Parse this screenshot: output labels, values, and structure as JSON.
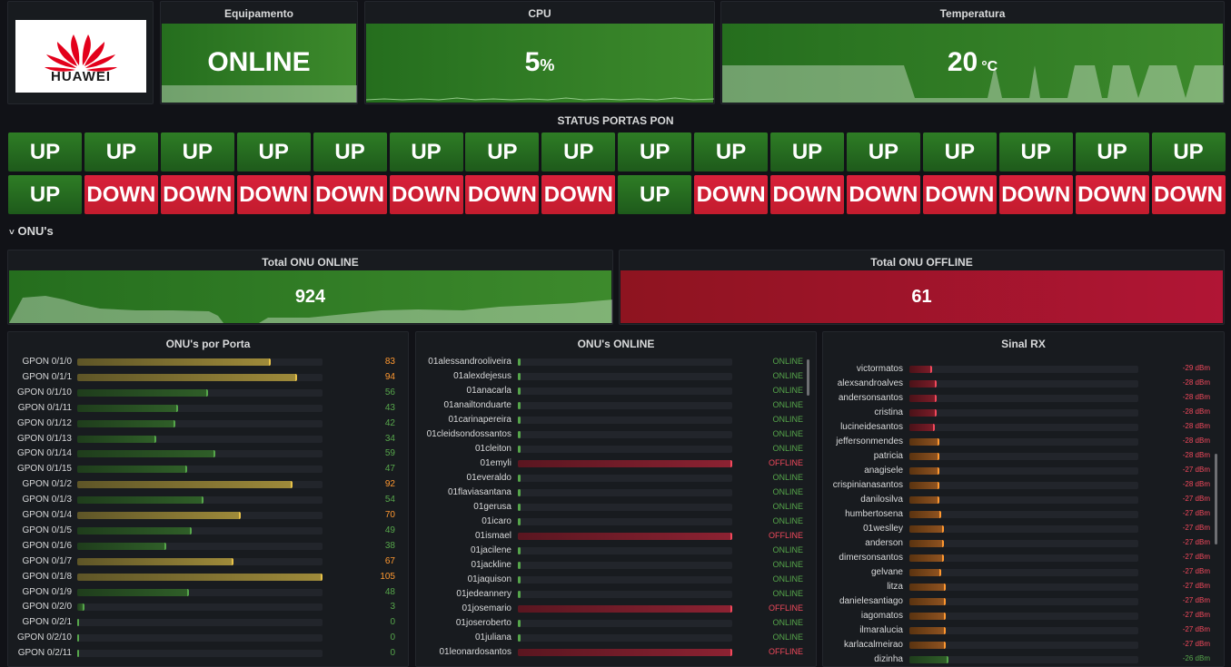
{
  "logo": {
    "brand": "HUAWEI",
    "color": "#e3001b"
  },
  "equipamento": {
    "title": "Equipamento",
    "value": "ONLINE"
  },
  "cpu": {
    "title": "CPU",
    "value": "5",
    "unit": "%"
  },
  "temperatura": {
    "title": "Temperatura",
    "value": "20",
    "unit": "°C"
  },
  "pon": {
    "title": "STATUS PORTAS PON",
    "row1": [
      "UP",
      "UP",
      "UP",
      "UP",
      "UP",
      "UP",
      "UP",
      "UP",
      "UP",
      "UP",
      "UP",
      "UP",
      "UP",
      "UP",
      "UP",
      "UP"
    ],
    "row2": [
      "UP",
      "DOWN",
      "DOWN",
      "DOWN",
      "DOWN",
      "DOWN",
      "DOWN",
      "DOWN",
      "UP",
      "DOWN",
      "DOWN",
      "DOWN",
      "DOWN",
      "DOWN",
      "DOWN",
      "DOWN"
    ]
  },
  "onus_row": {
    "title": "ONU's",
    "chevron": "chevron-down-icon"
  },
  "total_online": {
    "title": "Total ONU ONLINE",
    "value": "924"
  },
  "total_offline": {
    "title": "Total ONU OFFLINE",
    "value": "61"
  },
  "por_porta": {
    "title": "ONU's por Porta",
    "max": 105,
    "items": [
      {
        "label": "GPON 0/1/0",
        "value": 83,
        "color": "orange"
      },
      {
        "label": "GPON 0/1/1",
        "value": 94,
        "color": "orange"
      },
      {
        "label": "GPON 0/1/10",
        "value": 56,
        "color": "green"
      },
      {
        "label": "GPON 0/1/11",
        "value": 43,
        "color": "green"
      },
      {
        "label": "GPON 0/1/12",
        "value": 42,
        "color": "green"
      },
      {
        "label": "GPON 0/1/13",
        "value": 34,
        "color": "green"
      },
      {
        "label": "GPON 0/1/14",
        "value": 59,
        "color": "green"
      },
      {
        "label": "GPON 0/1/15",
        "value": 47,
        "color": "green"
      },
      {
        "label": "GPON 0/1/2",
        "value": 92,
        "color": "orange"
      },
      {
        "label": "GPON 0/1/3",
        "value": 54,
        "color": "green"
      },
      {
        "label": "GPON 0/1/4",
        "value": 70,
        "color": "orange"
      },
      {
        "label": "GPON 0/1/5",
        "value": 49,
        "color": "green"
      },
      {
        "label": "GPON 0/1/6",
        "value": 38,
        "color": "green"
      },
      {
        "label": "GPON 0/1/7",
        "value": 67,
        "color": "orange"
      },
      {
        "label": "GPON 0/1/8",
        "value": 105,
        "color": "orange"
      },
      {
        "label": "GPON 0/1/9",
        "value": 48,
        "color": "green"
      },
      {
        "label": "GPON 0/2/0",
        "value": 3,
        "color": "green"
      },
      {
        "label": "GPON 0/2/1",
        "value": 0,
        "color": "green"
      },
      {
        "label": "GPON 0/2/10",
        "value": 0,
        "color": "green"
      },
      {
        "label": "GPON 0/2/11",
        "value": 0,
        "color": "green"
      }
    ]
  },
  "onus_online": {
    "title": "ONU's ONLINE",
    "items": [
      {
        "name": "01alessandrooliveira",
        "status": "ONLINE"
      },
      {
        "name": "01alexdejesus",
        "status": "ONLINE"
      },
      {
        "name": "01anacarla",
        "status": "ONLINE"
      },
      {
        "name": "01anailtonduarte",
        "status": "ONLINE"
      },
      {
        "name": "01carinapereira",
        "status": "ONLINE"
      },
      {
        "name": "01cleidsondossantos",
        "status": "ONLINE"
      },
      {
        "name": "01cleiton",
        "status": "ONLINE"
      },
      {
        "name": "01emyli",
        "status": "OFFLINE"
      },
      {
        "name": "01everaldo",
        "status": "ONLINE"
      },
      {
        "name": "01flaviasantana",
        "status": "ONLINE"
      },
      {
        "name": "01gerusa",
        "status": "ONLINE"
      },
      {
        "name": "01icaro",
        "status": "ONLINE"
      },
      {
        "name": "01ismael",
        "status": "OFFLINE"
      },
      {
        "name": "01jacilene",
        "status": "ONLINE"
      },
      {
        "name": "01jackline",
        "status": "ONLINE"
      },
      {
        "name": "01jaquison",
        "status": "ONLINE"
      },
      {
        "name": "01jedeannery",
        "status": "ONLINE"
      },
      {
        "name": "01josemario",
        "status": "OFFLINE"
      },
      {
        "name": "01joseroberto",
        "status": "ONLINE"
      },
      {
        "name": "01juliana",
        "status": "ONLINE"
      },
      {
        "name": "01leonardosantos",
        "status": "OFFLINE"
      }
    ]
  },
  "sinal_rx": {
    "title": "Sinal RX",
    "items": [
      {
        "name": "victormatos",
        "value": "-29 dBm",
        "level": 0.1,
        "color": "red"
      },
      {
        "name": "alexsandroalves",
        "value": "-28 dBm",
        "level": 0.12,
        "color": "red"
      },
      {
        "name": "andersonsantos",
        "value": "-28 dBm",
        "level": 0.12,
        "color": "red"
      },
      {
        "name": "cristina",
        "value": "-28 dBm",
        "level": 0.12,
        "color": "red"
      },
      {
        "name": "lucineidesantos",
        "value": "-28 dBm",
        "level": 0.11,
        "color": "red"
      },
      {
        "name": "jeffersonmendes",
        "value": "-28 dBm",
        "level": 0.13,
        "color": "orange"
      },
      {
        "name": "patricia",
        "value": "-28 dBm",
        "level": 0.13,
        "color": "orange"
      },
      {
        "name": "anagisele",
        "value": "-27 dBm",
        "level": 0.13,
        "color": "orange"
      },
      {
        "name": "crispinianasantos",
        "value": "-28 dBm",
        "level": 0.13,
        "color": "orange"
      },
      {
        "name": "danilosilva",
        "value": "-27 dBm",
        "level": 0.13,
        "color": "orange"
      },
      {
        "name": "humbertosena",
        "value": "-27 dBm",
        "level": 0.14,
        "color": "orange"
      },
      {
        "name": "01weslley",
        "value": "-27 dBm",
        "level": 0.15,
        "color": "orange"
      },
      {
        "name": "anderson",
        "value": "-27 dBm",
        "level": 0.15,
        "color": "orange"
      },
      {
        "name": "dimersonsantos",
        "value": "-27 dBm",
        "level": 0.15,
        "color": "orange"
      },
      {
        "name": "gelvane",
        "value": "-27 dBm",
        "level": 0.14,
        "color": "orange"
      },
      {
        "name": "litza",
        "value": "-27 dBm",
        "level": 0.16,
        "color": "orange"
      },
      {
        "name": "danielesantiago",
        "value": "-27 dBm",
        "level": 0.16,
        "color": "orange"
      },
      {
        "name": "iagomatos",
        "value": "-27 dBm",
        "level": 0.16,
        "color": "orange"
      },
      {
        "name": "ilmaralucia",
        "value": "-27 dBm",
        "level": 0.16,
        "color": "orange"
      },
      {
        "name": "karlacalmeirao",
        "value": "-27 dBm",
        "level": 0.16,
        "color": "orange"
      },
      {
        "name": "dizinha",
        "value": "-26 dBm",
        "level": 0.17,
        "color": "green"
      }
    ]
  },
  "colors": {
    "green": "#3d8a2c",
    "orange": "#c9a23b",
    "red": "#c4162a",
    "online_text": "#56a64b",
    "offline_text": "#f2495c",
    "orange_text": "#ff9830",
    "green_text": "#56a64b"
  }
}
